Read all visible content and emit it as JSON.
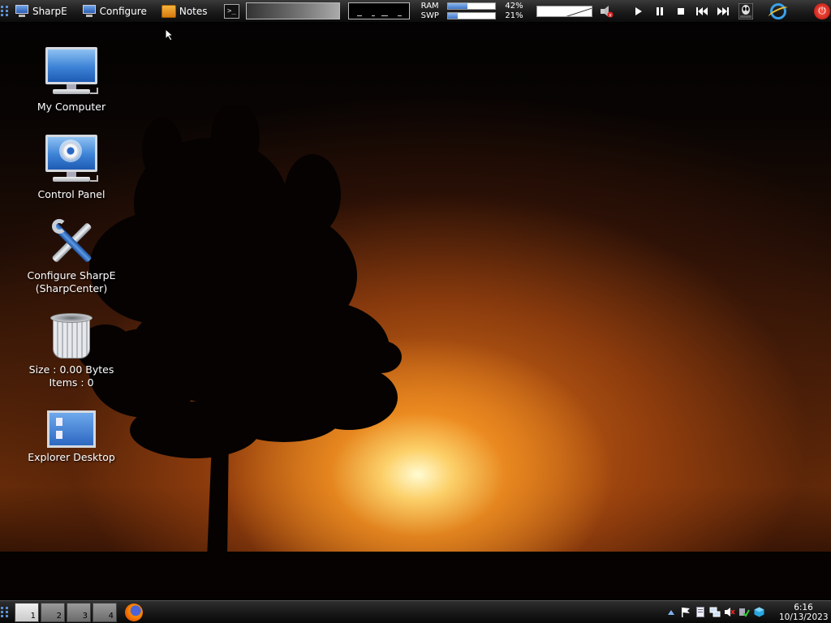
{
  "top_panel": {
    "launchers": [
      {
        "label": "SharpE",
        "icon": "monitor-icon"
      },
      {
        "label": "Configure",
        "icon": "monitor-icon"
      },
      {
        "label": "Notes",
        "icon": "notes-icon"
      }
    ],
    "terminal_glyph": ">_",
    "memory": {
      "ram_label": "RAM",
      "ram_percent": "42%",
      "ram_value": 42,
      "swap_label": "SWP",
      "swap_percent": "21%",
      "swap_value": 21
    },
    "media_icons": [
      "play-icon",
      "pause-icon",
      "stop-icon",
      "previous-icon",
      "next-icon"
    ]
  },
  "desktop_icons": [
    {
      "label": "My Computer",
      "icon": "computer-icon"
    },
    {
      "label": "Control Panel",
      "icon": "control-panel-icon"
    },
    {
      "label_line1": "Configure SharpE",
      "label_line2": "(SharpCenter)",
      "icon": "tools-icon"
    },
    {
      "label_line1": "Size : 0.00 Bytes",
      "label_line2": "Items : 0",
      "icon": "trash-icon"
    },
    {
      "label": "Explorer Desktop",
      "icon": "explorer-desktop-icon"
    }
  ],
  "bottom_panel": {
    "pages": [
      "1",
      "2",
      "3",
      "4"
    ],
    "active_page": "1",
    "clock_time": "6:16",
    "clock_date": "10/13/2023"
  },
  "colors": {
    "accent": "#3d76c8",
    "power": "#d0180e"
  }
}
